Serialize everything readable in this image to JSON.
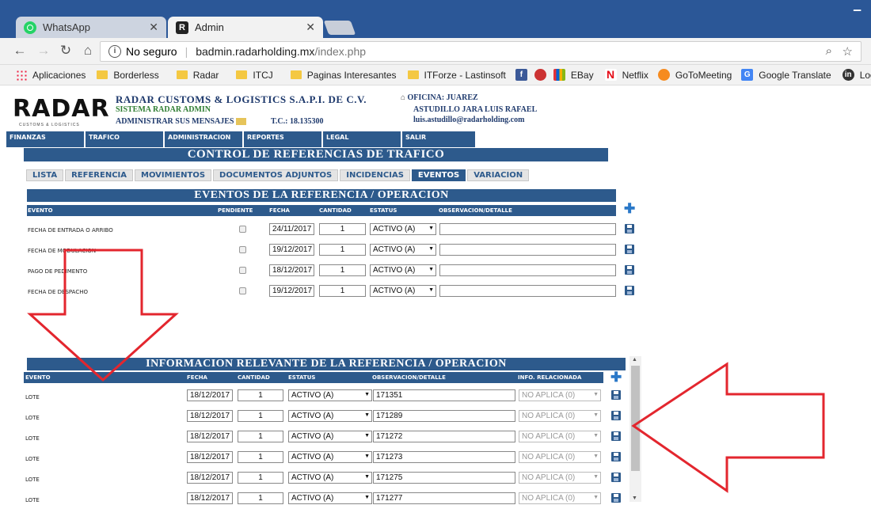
{
  "browser": {
    "tabs": [
      {
        "title": "WhatsApp",
        "icon": "whatsapp-icon"
      },
      {
        "title": "Admin",
        "icon": "radar-icon"
      }
    ],
    "address": {
      "security": "No seguro",
      "host": "badmin.radarholding.mx",
      "path": "/index.php"
    },
    "bookmarks": [
      {
        "label": "Aplicaciones",
        "icon": "apps-icon"
      },
      {
        "label": "Borderless",
        "icon": "folder-icon"
      },
      {
        "label": "Radar",
        "icon": "folder-icon"
      },
      {
        "label": "ITCJ",
        "icon": "folder-icon"
      },
      {
        "label": "Paginas Interesantes",
        "icon": "folder-icon"
      },
      {
        "label": "ITForze - Lastinsoft",
        "icon": "folder-icon"
      },
      {
        "label": "",
        "icon": "facebook-icon"
      },
      {
        "label": "",
        "icon": "bird-icon"
      },
      {
        "label": "EBay",
        "icon": "ebay-icon"
      },
      {
        "label": "Netflix",
        "icon": "netflix-icon"
      },
      {
        "label": "GoToMeeting",
        "icon": "gotomeeting-icon"
      },
      {
        "label": "Google Translate",
        "icon": "translate-icon"
      },
      {
        "label": "LogMe",
        "icon": "linkedin-icon"
      }
    ]
  },
  "header": {
    "logo": "RADAR",
    "logo_sub": "CUSTOMS & LOGISTICS",
    "company": "RADAR CUSTOMS & LOGISTICS S.A.P.I. DE C.V.",
    "system": "SISTEMA RADAR ADMIN",
    "messages": "ADMINISTRAR SUS MENSAJES",
    "tc": "T.C.: 18.135300",
    "office": "OFICINA: JUAREZ",
    "user": "ASTUDILLO JARA LUIS RAFAEL",
    "email": "luis.astudillo@radarholding.com"
  },
  "menu": [
    "FINANZAS",
    "TRAFICO",
    "ADMINISTRACION",
    "REPORTES",
    "LEGAL",
    "SALIR"
  ],
  "control_title": "CONTROL DE REFERENCIAS DE TRAFICO",
  "subtabs": [
    "LISTA",
    "REFERENCIA",
    "MOVIMIENTOS",
    "DOCUMENTOS ADJUNTOS",
    "INCIDENCIAS",
    "EVENTOS",
    "VARIACION"
  ],
  "active_subtab": "EVENTOS",
  "events": {
    "title": "EVENTOS DE LA REFERENCIA / OPERACION",
    "columns": [
      "EVENTO",
      "PENDIENTE",
      "FECHA",
      "CANTIDAD",
      "ESTATUS",
      "OBSERVACION/DETALLE"
    ],
    "rows": [
      {
        "evento": "FECHA DE ENTRADA O ARRIBO",
        "fecha": "24/11/2017",
        "cantidad": "1",
        "estatus": "ACTIVO (A)",
        "obs": ""
      },
      {
        "evento": "FECHA DE MODULACION",
        "fecha": "19/12/2017",
        "cantidad": "1",
        "estatus": "ACTIVO (A)",
        "obs": ""
      },
      {
        "evento": "PAGO DE PEDIMENTO",
        "fecha": "18/12/2017",
        "cantidad": "1",
        "estatus": "ACTIVO (A)",
        "obs": ""
      },
      {
        "evento": "FECHA DE DESPACHO",
        "fecha": "19/12/2017",
        "cantidad": "1",
        "estatus": "ACTIVO (A)",
        "obs": ""
      }
    ]
  },
  "relevant": {
    "title": "INFORMACION RELEVANTE DE LA REFERENCIA / OPERACION",
    "columns": [
      "EVENTO",
      "FECHA",
      "CANTIDAD",
      "ESTATUS",
      "OBSERVACION/DETALLE",
      "INFO. RELACIONADA"
    ],
    "rows": [
      {
        "evento": "LOTE",
        "fecha": "18/12/2017",
        "cantidad": "1",
        "estatus": "ACTIVO (A)",
        "obs": "171351",
        "info": "NO APLICA (0)"
      },
      {
        "evento": "LOTE",
        "fecha": "18/12/2017",
        "cantidad": "1",
        "estatus": "ACTIVO (A)",
        "obs": "171289",
        "info": "NO APLICA (0)"
      },
      {
        "evento": "LOTE",
        "fecha": "18/12/2017",
        "cantidad": "1",
        "estatus": "ACTIVO (A)",
        "obs": "171272",
        "info": "NO APLICA (0)"
      },
      {
        "evento": "LOTE",
        "fecha": "18/12/2017",
        "cantidad": "1",
        "estatus": "ACTIVO (A)",
        "obs": "171273",
        "info": "NO APLICA (0)"
      },
      {
        "evento": "LOTE",
        "fecha": "18/12/2017",
        "cantidad": "1",
        "estatus": "ACTIVO (A)",
        "obs": "171275",
        "info": "NO APLICA (0)"
      },
      {
        "evento": "LOTE",
        "fecha": "18/12/2017",
        "cantidad": "1",
        "estatus": "ACTIVO (A)",
        "obs": "171277",
        "info": "NO APLICA (0)"
      }
    ]
  },
  "colors": {
    "brand": "#2d5a8c",
    "annotation": "#e3262e",
    "add": "#2a78c8"
  }
}
